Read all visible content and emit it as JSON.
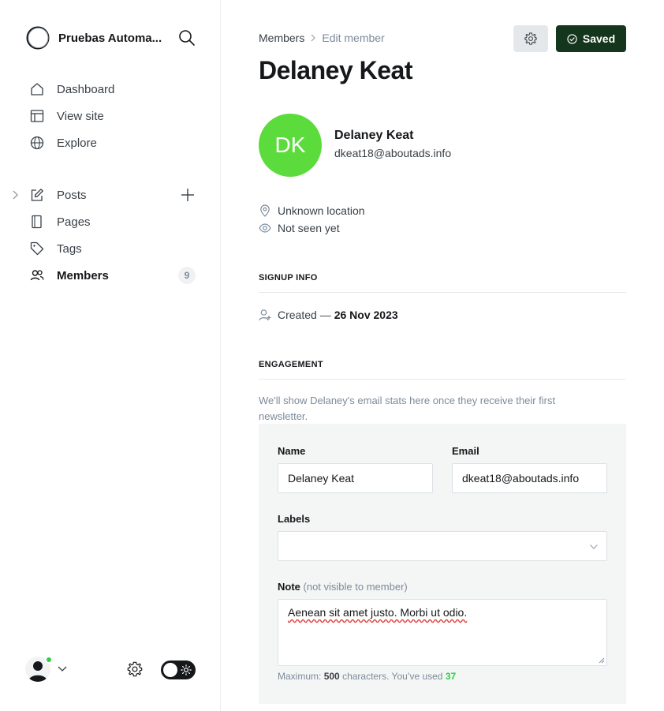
{
  "sidebar": {
    "site_name": "Pruebas Automa...",
    "nav_primary": [
      {
        "label": "Dashboard",
        "icon": "home-icon"
      },
      {
        "label": "View site",
        "icon": "layout-icon"
      },
      {
        "label": "Explore",
        "icon": "globe-icon"
      }
    ],
    "nav_secondary": [
      {
        "label": "Posts",
        "icon": "pen-icon"
      },
      {
        "label": "Pages",
        "icon": "page-icon"
      },
      {
        "label": "Tags",
        "icon": "tag-icon"
      },
      {
        "label": "Members",
        "icon": "members-icon",
        "count": "9",
        "active": true
      }
    ]
  },
  "header": {
    "breadcrumb_parent": "Members",
    "breadcrumb_current": "Edit member",
    "saved_label": "Saved",
    "title": "Delaney Keat"
  },
  "member": {
    "initials": "DK",
    "name": "Delaney Keat",
    "email": "dkeat18@aboutads.info",
    "avatar_color": "#5cdc3c",
    "location": "Unknown location",
    "seen": "Not seen yet"
  },
  "signup": {
    "heading": "SIGNUP INFO",
    "created_prefix": "Created —",
    "created_date": "26 Nov 2023"
  },
  "engagement": {
    "heading": "ENGAGEMENT",
    "note": "We'll show Delaney's email stats here once they receive their first newsletter."
  },
  "form": {
    "name_label": "Name",
    "name_value": "Delaney Keat",
    "email_label": "Email",
    "email_value": "dkeat18@aboutads.info",
    "labels_label": "Labels",
    "labels_value": "",
    "note_label": "Note",
    "note_hint": "(not visible to member)",
    "note_value": "Aenean sit amet justo. Morbi ut odio.",
    "max_prefix": "Maximum:",
    "max_value": "500",
    "max_mid": "characters. You’ve used",
    "used_value": "37"
  },
  "colors": {
    "accent_dark_green": "#14361c",
    "online_green": "#30cf43"
  }
}
